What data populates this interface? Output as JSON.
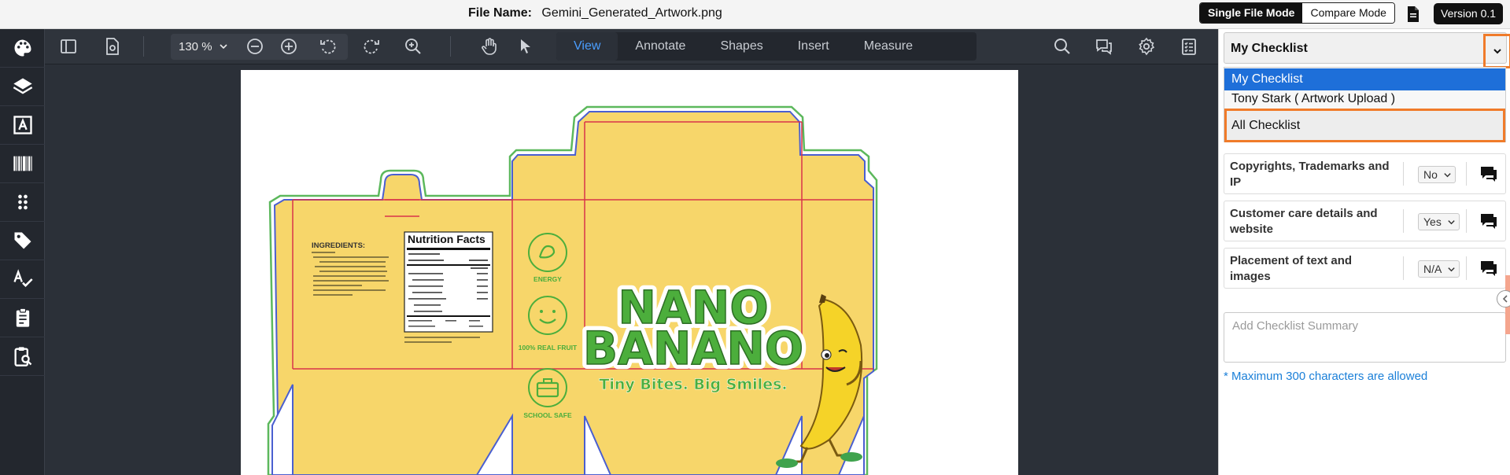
{
  "header": {
    "file_name_label": "File Name:",
    "file_name_value": "Gemini_Generated_Artwork.png",
    "modes": {
      "single": "Single File Mode",
      "compare": "Compare Mode"
    },
    "doc_icon": "document-icon",
    "version": "Version 0.1"
  },
  "left_sidebar": {
    "items": [
      {
        "icon": "palette-icon"
      },
      {
        "icon": "layers-icon"
      },
      {
        "icon": "text-icon"
      },
      {
        "icon": "barcode-icon"
      },
      {
        "icon": "grip-dots-icon"
      },
      {
        "icon": "tag-icon"
      },
      {
        "icon": "spellcheck-icon"
      },
      {
        "icon": "clipboard-icon"
      },
      {
        "icon": "clipboard-search-icon"
      }
    ]
  },
  "toolbar": {
    "zoom": "130 %",
    "tabs": [
      "View",
      "Annotate",
      "Shapes",
      "Insert",
      "Measure"
    ],
    "active_tab": "View",
    "icons": [
      "sidebar-toggle-icon",
      "page-settings-icon",
      "zoom-out-icon",
      "zoom-in-icon",
      "rotate-left-icon",
      "rotate-right-icon",
      "zoom-area-icon",
      "hand-pan-icon",
      "pointer-icon",
      "search-icon",
      "comments-icon",
      "settings-icon",
      "checklist-icon"
    ]
  },
  "artwork": {
    "ingredients_title": "INGREDIENTS:",
    "nutrition_title": "Nutrition Facts",
    "badges": [
      "ENERGY",
      "100% REAL FRUIT",
      "SCHOOL SAFE"
    ],
    "brand_line1": "NANO",
    "brand_line2": "BANANO",
    "tagline": "Tiny Bites. Big Smiles.",
    "colors": {
      "box": "#f7d66a",
      "dieline_green": "#5cb85c",
      "dieline_blue": "#4a5fd0",
      "fold_red": "#d8334a",
      "brand_green": "#4cae3c"
    }
  },
  "checklist": {
    "selected": "My Checklist",
    "options": [
      "My Checklist",
      "Tony Stark ( Artwork Upload )",
      "All Checklist"
    ],
    "items": [
      {
        "label": "Copyrights, Trademarks and IP",
        "value": "No"
      },
      {
        "label": "Customer care details and website",
        "value": "Yes"
      },
      {
        "label": "Placement of text and images",
        "value": "N/A"
      }
    ],
    "summary_placeholder": "Add Checklist Summary",
    "max_note": "* Maximum 300 characters are allowed",
    "accent_color": "#f07b2a",
    "select_color": "#1e6fd9"
  }
}
